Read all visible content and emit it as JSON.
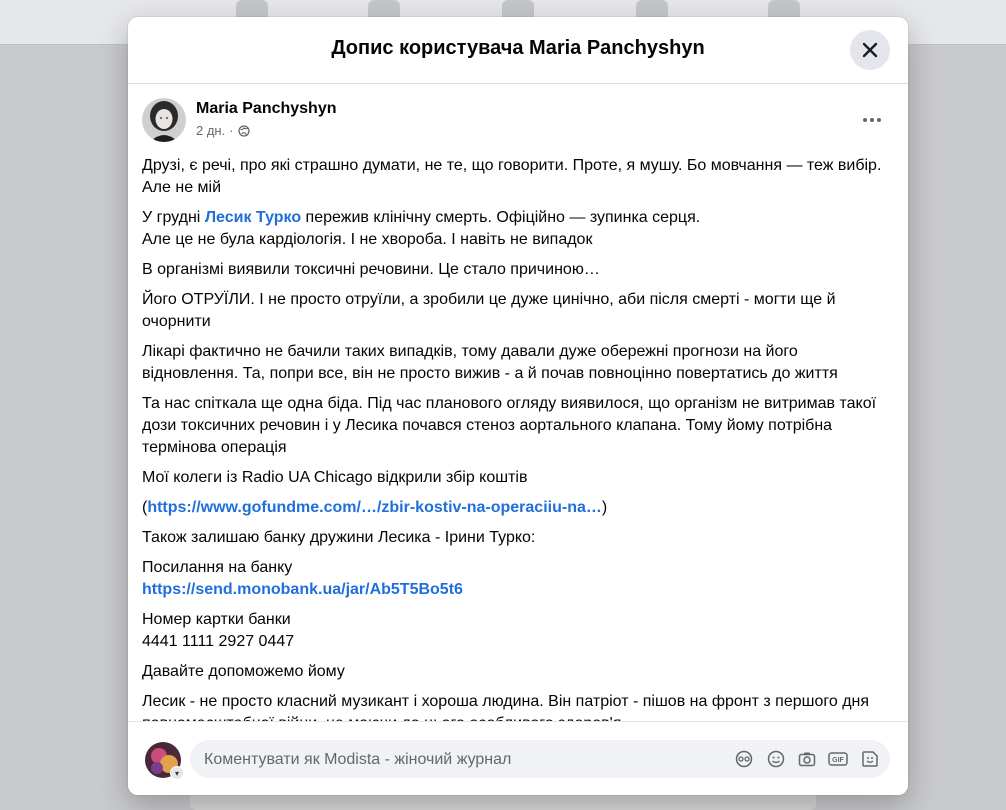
{
  "modal": {
    "title": "Допис користувача Maria Panchyshyn"
  },
  "post": {
    "author": "Maria Panchyshyn",
    "time": "2 дн.",
    "separator": "·",
    "paragraphs": {
      "p1": "Друзі, є речі, про які страшно думати, не те, що говорити. Проте, я мушу. Бо мовчання — теж вибір. Але не мій",
      "p2_prefix": "У грудні ",
      "p2_mention": "Лесик Турко",
      "p2_suffix": " пережив клінічну смерть. Офіційно — зупинка серця.",
      "p2_line2": "Але це не була кардіологія. І не хвороба. І навіть не випадок",
      "p3": "В організмі виявили токсичні речовини. Це стало причиною…",
      "p4": "Його ОТРУЇЛИ. І не просто отруїли, а зробили це дуже цинічно, аби після смерті - могти ще й очорнити",
      "p5": "Лікарі фактично не бачили таких випадків, тому давали дуже обережні прогнози на його відновлення. Та, попри все, він не просто вижив - а й почав повноцінно повертатись до життя",
      "p6": "Та нас спіткала ще одна біда. Під час планового огляду виявилося, що організм не витримав такої дози токсичних речовин і у Лесика почався стеноз аортального клапана. Тому йому потрібна термінова операція",
      "p7": "Мої колеги із Radio UA Chicago відкрили збір коштів",
      "p8_open": "(",
      "p8_link": "https://www.gofundme.com/…/zbir-kostiv-na-operaciiu-na…",
      "p8_close": ")",
      "p9": "Також залишаю банку дружини Лесика - Ірини Турко:",
      "p10_label": "Посилання на банку",
      "p10_link": "https://send.monobank.ua/jar/Ab5T5Bo5t6",
      "p11_label": "Номер картки банки",
      "p11_number": "4441 1111 2927 0447",
      "p12": "Давайте допоможемо йому",
      "p13": "Лесик - не просто класний музикант і хороша людина. Він патріот - пішов на фронт з першого дня повномасштабної війни, не маючи до цього особливого здоров'я"
    }
  },
  "comment": {
    "placeholder": "Коментувати як Modista - жіночий журнал"
  },
  "icons": {
    "close": "close-icon",
    "more": "more-icon",
    "globe": "globe-icon",
    "avatar_sticker": "avatar-sticker-icon",
    "emoji": "emoji-icon",
    "camera": "camera-icon",
    "gif": "gif-icon",
    "sticker": "sticker-icon",
    "chevron": "chevron-down-icon"
  },
  "colors": {
    "link": "#216fdb",
    "text": "#050505",
    "muted": "#65676b",
    "input_bg": "#f0f2f5"
  }
}
